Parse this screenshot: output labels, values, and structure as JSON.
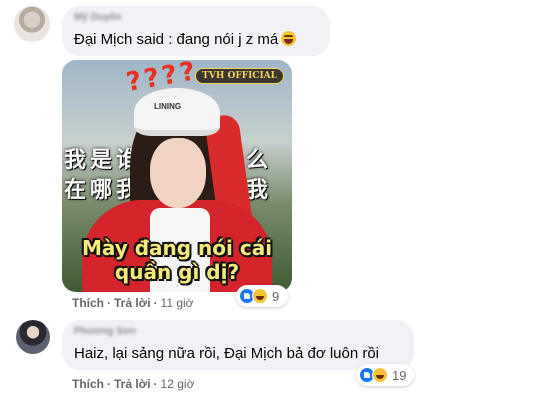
{
  "comments": [
    {
      "author": "Mỹ Duyên",
      "text": "Đại Mịch said : đang nói j z má",
      "emoji": "laughing-emoji",
      "sticker": {
        "watermark": "TVH OFFICIAL",
        "question_marks": "????",
        "cap_label": "LINING",
        "background_text": "我是谁我在干什么在哪我是谁在哪我",
        "caption_line1": "Mày đang nói cái",
        "caption_line2": "quần gì dị?"
      },
      "actions": {
        "like": "Thích",
        "reply": "Trả lời",
        "time": "11 giờ"
      },
      "reactions": {
        "types": [
          "like",
          "haha"
        ],
        "count": "9"
      }
    },
    {
      "author": "Phương Sơn",
      "text": "Haiz, lại sảng nữa rồi, Đại Mịch bả đơ luôn rồi",
      "actions": {
        "like": "Thích",
        "reply": "Trả lời",
        "time": "12 giờ"
      },
      "reactions": {
        "types": [
          "like",
          "haha"
        ],
        "count": "19"
      }
    }
  ],
  "separator": "·",
  "colors": {
    "bubble": "#f0f2f5",
    "meta": "#65676b",
    "like_blue": "#1877f2",
    "haha_yellow": "#f7c33a"
  }
}
